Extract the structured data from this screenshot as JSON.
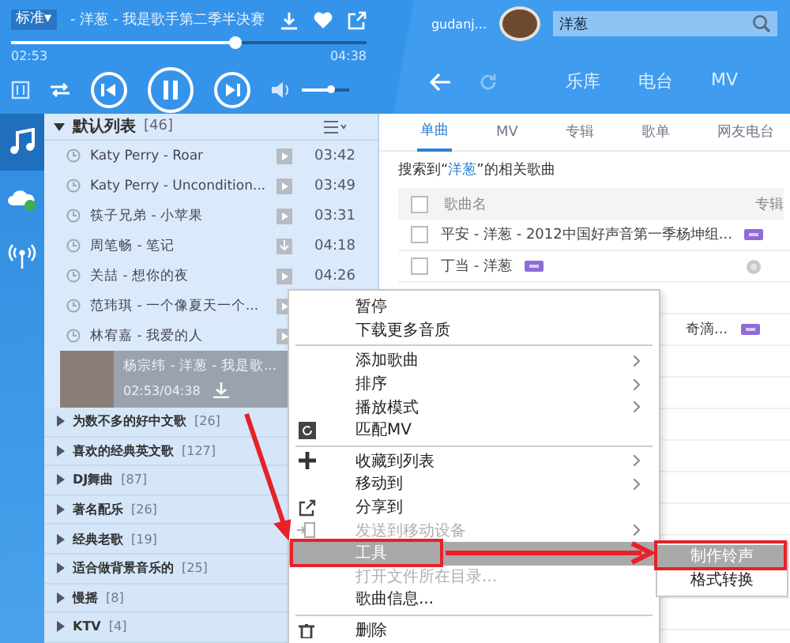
{
  "player": {
    "quality": "标准▾",
    "now_title": "- 洋葱 - 我是歌手第二季半决赛",
    "elapsed": "02:53",
    "total": "04:38",
    "progress": {
      "level": 0.63
    },
    "volume": {
      "level": 0.6
    }
  },
  "account": {
    "user": "gudanj...",
    "search": {
      "value": "洋葱"
    }
  },
  "nav": [
    {
      "label": "乐库",
      "selected": false
    },
    {
      "label": "电台",
      "selected": false
    },
    {
      "label": "MV",
      "selected": false
    }
  ],
  "rail": [
    {
      "selected": true
    },
    {
      "selected": false
    },
    {
      "selected": false
    }
  ],
  "playlist": {
    "name": "默认列表",
    "count": "[46]",
    "expanded": true,
    "songs": [
      {
        "title": "Katy Perry - Roar",
        "duration": "03:42",
        "local": false
      },
      {
        "title": "Katy Perry - Uncondition...",
        "duration": "03:49",
        "local": false
      },
      {
        "title": "筷子兄弟 - 小苹果",
        "duration": "03:31",
        "local": false
      },
      {
        "title": "周笔畅 - 笔记",
        "duration": "04:18",
        "local": true
      },
      {
        "title": "关喆 - 想你的夜",
        "duration": "04:26",
        "local": false
      },
      {
        "title": "范玮琪 - 一个像夏天一个...",
        "local": false
      },
      {
        "title": "林宥嘉 - 我爱的人",
        "local": false
      }
    ],
    "now_playing": {
      "title": "杨宗纬 - 洋葱 - 我是歌...",
      "time": "02:53/04:38"
    }
  },
  "groups": [
    {
      "name": "为数不多的好中文歌",
      "count": "[26]"
    },
    {
      "name": "喜欢的经典英文歌",
      "count": "[127]"
    },
    {
      "name": "DJ舞曲",
      "count": "[87]"
    },
    {
      "name": "著名配乐",
      "count": "[26]"
    },
    {
      "name": "经典老歌",
      "count": "[19]"
    },
    {
      "name": "适合做背景音乐的",
      "count": "[25]"
    },
    {
      "name": "慢摇",
      "count": "[8]"
    },
    {
      "name": "KTV",
      "count": "[4]"
    }
  ],
  "results": {
    "tabs": [
      {
        "label": "单曲",
        "selected": true
      },
      {
        "label": "MV",
        "selected": false
      },
      {
        "label": "专辑",
        "selected": false
      },
      {
        "label": "歌单",
        "selected": false
      },
      {
        "label": "网友电台",
        "selected": false
      }
    ],
    "summary": {
      "before": "搜索到“",
      "keyword": "洋葱",
      "after": "”的相关歌曲"
    },
    "select_all": {
      "checked": false
    },
    "columns": [
      "歌曲名",
      "专辑"
    ],
    "rows": [
      {
        "title": "平安 - 洋葱 - 2012中国好声音第一季杨坤组...",
        "tagged": true,
        "checked": false
      },
      {
        "title": "丁当 - 洋葱",
        "tagged": true,
        "checked": false
      }
    ],
    "partial_text": "奇滴..."
  },
  "context_menu": [
    {
      "kind": "text",
      "label": "暂停",
      "submenu": false,
      "disabled": false,
      "selected": false
    },
    {
      "kind": "text",
      "label": "下载更多音质",
      "submenu": false,
      "disabled": false,
      "selected": false
    },
    {
      "kind": "separator"
    },
    {
      "kind": "text",
      "label": "添加歌曲",
      "submenu": true,
      "disabled": false,
      "selected": false
    },
    {
      "kind": "text",
      "label": "排序",
      "submenu": true,
      "disabled": false,
      "selected": false
    },
    {
      "kind": "text",
      "label": "播放模式",
      "submenu": true,
      "disabled": false,
      "selected": false
    },
    {
      "kind": "mv",
      "label": "匹配MV",
      "submenu": false,
      "disabled": false,
      "selected": false
    },
    {
      "kind": "separator"
    },
    {
      "kind": "add",
      "label": "收藏到列表",
      "submenu": true,
      "disabled": false,
      "selected": false
    },
    {
      "kind": "text",
      "label": "移动到",
      "submenu": true,
      "disabled": false,
      "selected": false
    },
    {
      "kind": "share",
      "label": "分享到",
      "submenu": false,
      "disabled": false,
      "selected": false
    },
    {
      "kind": "send",
      "label": "发送到移动设备",
      "submenu": true,
      "disabled": true,
      "selected": false
    },
    {
      "kind": "text",
      "label": "工具",
      "submenu": false,
      "disabled": false,
      "selected": true
    },
    {
      "kind": "text",
      "label": "打开文件所在目录...",
      "submenu": false,
      "disabled": true,
      "selected": false
    },
    {
      "kind": "text",
      "label": "歌曲信息...",
      "submenu": false,
      "disabled": false,
      "selected": false
    },
    {
      "kind": "separator"
    },
    {
      "kind": "delete",
      "label": "删除",
      "submenu": false,
      "disabled": false,
      "selected": false
    }
  ],
  "submenu": [
    {
      "label": "制作铃声",
      "selected": true
    },
    {
      "label": "格式转换",
      "selected": false
    }
  ]
}
